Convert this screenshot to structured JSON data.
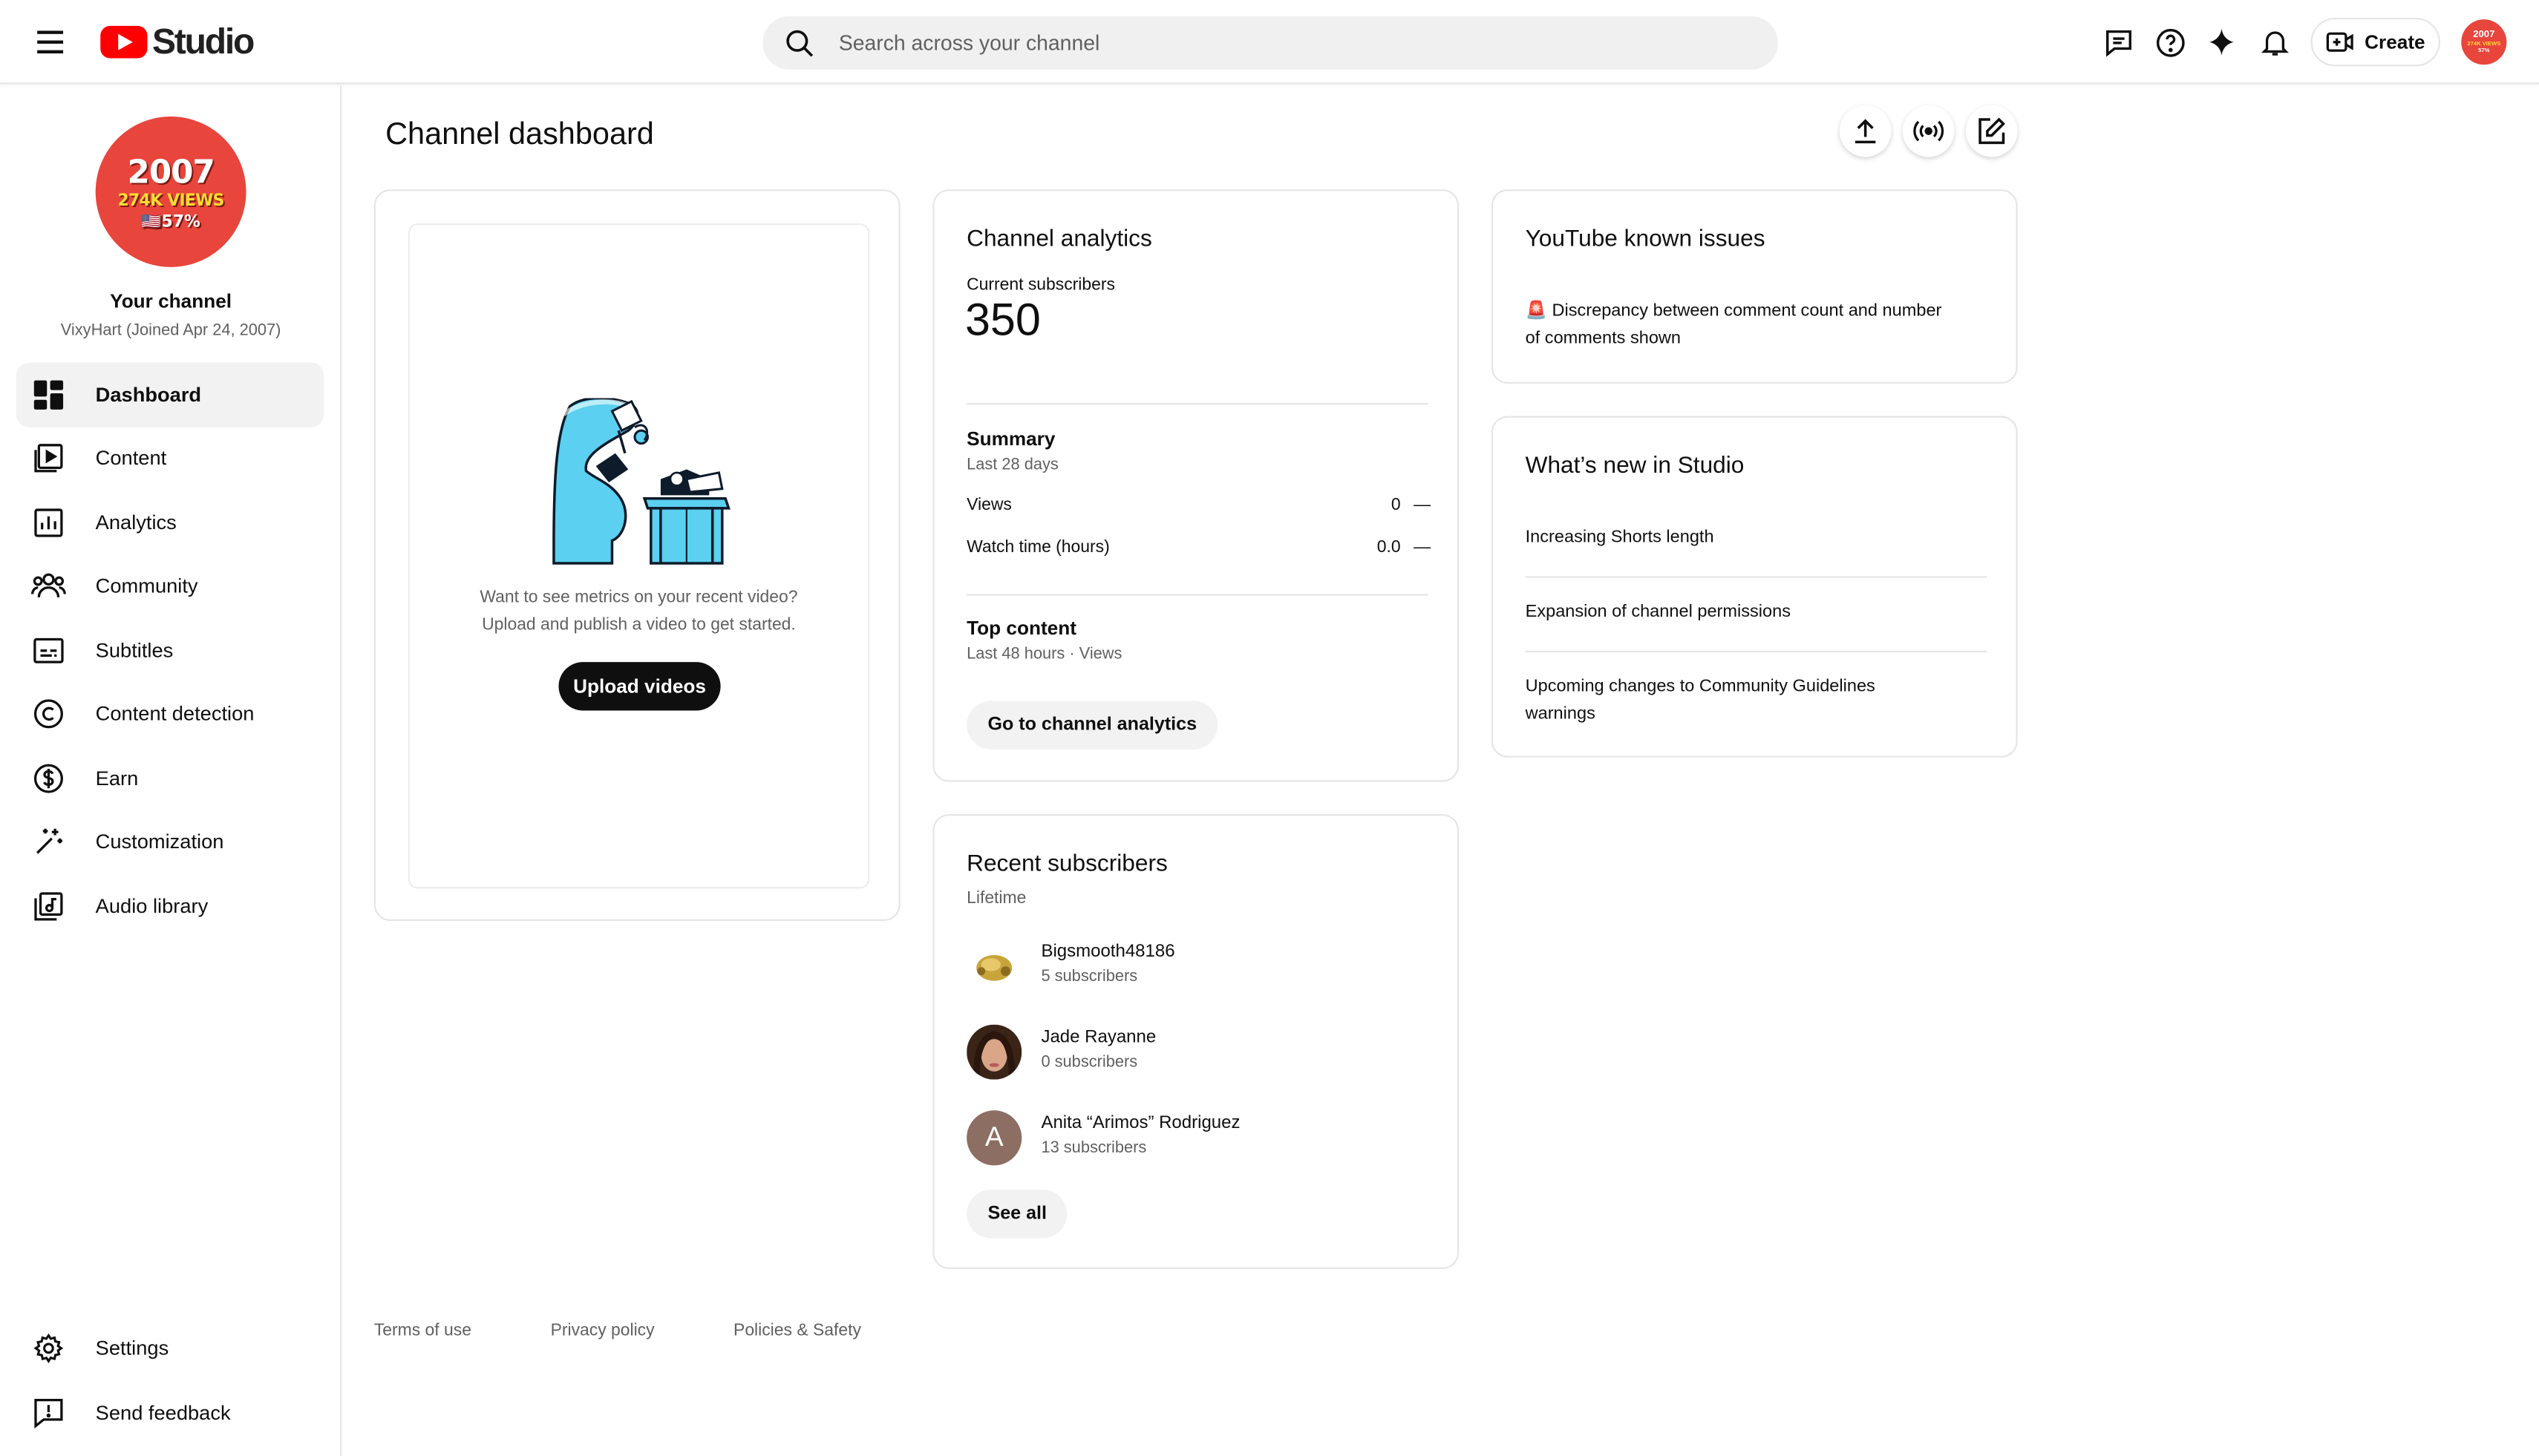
{
  "header": {
    "logo_text": "Studio",
    "search_placeholder": "Search across your channel",
    "create_label": "Create",
    "avatar_lines": [
      "2007",
      "274K VIEWS",
      "57%"
    ]
  },
  "sidebar": {
    "channel_avatar": {
      "line1": "2007",
      "line2": "274K VIEWS",
      "line3": "🇺🇸57%"
    },
    "channel_title": "Your channel",
    "channel_subtitle": "VixyHart (Joined Apr 24, 2007)",
    "items": [
      {
        "label": "Dashboard",
        "icon": "dashboard-icon",
        "active": true
      },
      {
        "label": "Content",
        "icon": "content-icon"
      },
      {
        "label": "Analytics",
        "icon": "analytics-icon"
      },
      {
        "label": "Community",
        "icon": "community-icon"
      },
      {
        "label": "Subtitles",
        "icon": "subtitles-icon"
      },
      {
        "label": "Content detection",
        "icon": "copyright-icon"
      },
      {
        "label": "Earn",
        "icon": "dollar-icon"
      },
      {
        "label": "Customization",
        "icon": "magic-wand-icon"
      },
      {
        "label": "Audio library",
        "icon": "audio-library-icon"
      }
    ],
    "bottom_items": [
      {
        "label": "Settings",
        "icon": "gear-icon"
      },
      {
        "label": "Send feedback",
        "icon": "feedback-icon"
      }
    ]
  },
  "main": {
    "page_title": "Channel dashboard",
    "upload_card": {
      "text_line1": "Want to see metrics on your recent video?",
      "text_line2": "Upload and publish a video to get started.",
      "button": "Upload videos"
    },
    "analytics_card": {
      "title": "Channel analytics",
      "subs_label": "Current subscribers",
      "subs_value": "350",
      "summary_title": "Summary",
      "summary_period": "Last 28 days",
      "rows": [
        {
          "label": "Views",
          "value": "0",
          "trend": "—"
        },
        {
          "label": "Watch time (hours)",
          "value": "0.0",
          "trend": "—"
        }
      ],
      "top_title": "Top content",
      "top_period": "Last 48 hours · Views",
      "button": "Go to channel analytics"
    },
    "subscribers_card": {
      "title": "Recent subscribers",
      "period": "Lifetime",
      "subscribers": [
        {
          "name": "Bigsmooth48186",
          "count": "5 subscribers"
        },
        {
          "name": "Jade Rayanne",
          "count": "0 subscribers"
        },
        {
          "name": "Anita “Arimos” Rodriguez",
          "count": "13 subscribers",
          "initial": "A"
        }
      ],
      "button": "See all"
    },
    "issues_card": {
      "title": "YouTube known issues",
      "line1": "🚨 Discrepancy between comment count and number",
      "line2": "of comments shown"
    },
    "news_card": {
      "title": "What’s new in Studio",
      "items": [
        {
          "line1": "Increasing Shorts length",
          "line2": ""
        },
        {
          "line1": "Expansion of channel permissions",
          "line2": ""
        },
        {
          "line1": "Upcoming changes to Community Guidelines",
          "line2": "warnings"
        }
      ]
    }
  },
  "footer": {
    "links": [
      "Terms of use",
      "Privacy policy",
      "Policies & Safety"
    ]
  },
  "colors": {
    "brand_red": "#ff0000",
    "avatar_red": "#e8453c",
    "text_primary": "#0f0f0f",
    "text_secondary": "#606060",
    "active_bg": "#f2f2f2"
  }
}
